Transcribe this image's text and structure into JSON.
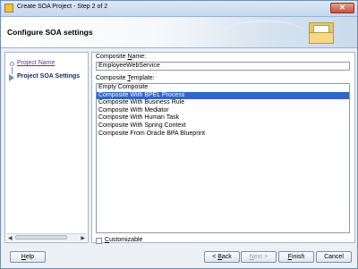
{
  "window": {
    "title": "Create SOA Project - Step 2 of 2",
    "close_glyph": "✕"
  },
  "header": {
    "title": "Configure SOA settings",
    "icon": "folder-icon"
  },
  "steps": [
    {
      "label": "Project Name",
      "state": "visited"
    },
    {
      "label": "Project SOA Settings",
      "state": "current"
    }
  ],
  "scroll": {
    "left": "◀",
    "right": "▶"
  },
  "form": {
    "name_label_pre": "Composite ",
    "name_label_accel": "N",
    "name_label_post": "ame:",
    "name_value": "EmployeeWebService",
    "template_label_pre": "Composite ",
    "template_label_accel": "T",
    "template_label_post": "emplate:",
    "templates": [
      "Empty Composite",
      "Composite With BPEL Process",
      "Composite With Business Rule",
      "Composite With Mediator",
      "Composite With Human Task",
      "Composite With Spring Context",
      "Composite From Oracle BPA Blueprint"
    ],
    "selected_index": 1,
    "customizable_accel": "C",
    "customizable_rest": "ustomizable"
  },
  "buttons": {
    "help_accel": "H",
    "help_rest": "elp",
    "back_prefix": "< ",
    "back_accel": "B",
    "back_rest": "ack",
    "next_accel": "N",
    "next_rest": "ext >",
    "finish_accel": "F",
    "finish_rest": "inish",
    "cancel": "Cancel"
  },
  "colors": {
    "selection": "#3066c6",
    "visited_link": "#5a3d8a"
  }
}
